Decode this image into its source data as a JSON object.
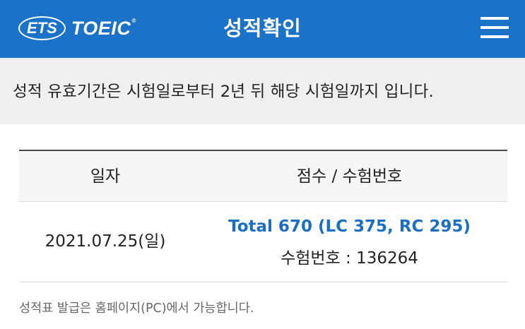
{
  "header": {
    "logo_ets": "ETS",
    "logo_toeic": "TOEIC",
    "logo_reg": "®",
    "title": "성적확인",
    "menu_icon": "hamburger-menu-icon",
    "background_color": "#1a73c8"
  },
  "notice": {
    "text": "성적 유효기간은 시험일로부터 2년 뒤 해당 시험일까지 입니다."
  },
  "table": {
    "headers": [
      "일자",
      "점수 / 수험번호"
    ],
    "rows": [
      {
        "date": "2021.07.25(일)",
        "total": "Total 670 (LC 375, RC 295)",
        "registration": "수험번호 : 136264"
      }
    ],
    "accent_color": "#1a6fc2"
  },
  "footer": {
    "note": "성적표 발급은 홈페이지(PC)에서 가능합니다."
  }
}
